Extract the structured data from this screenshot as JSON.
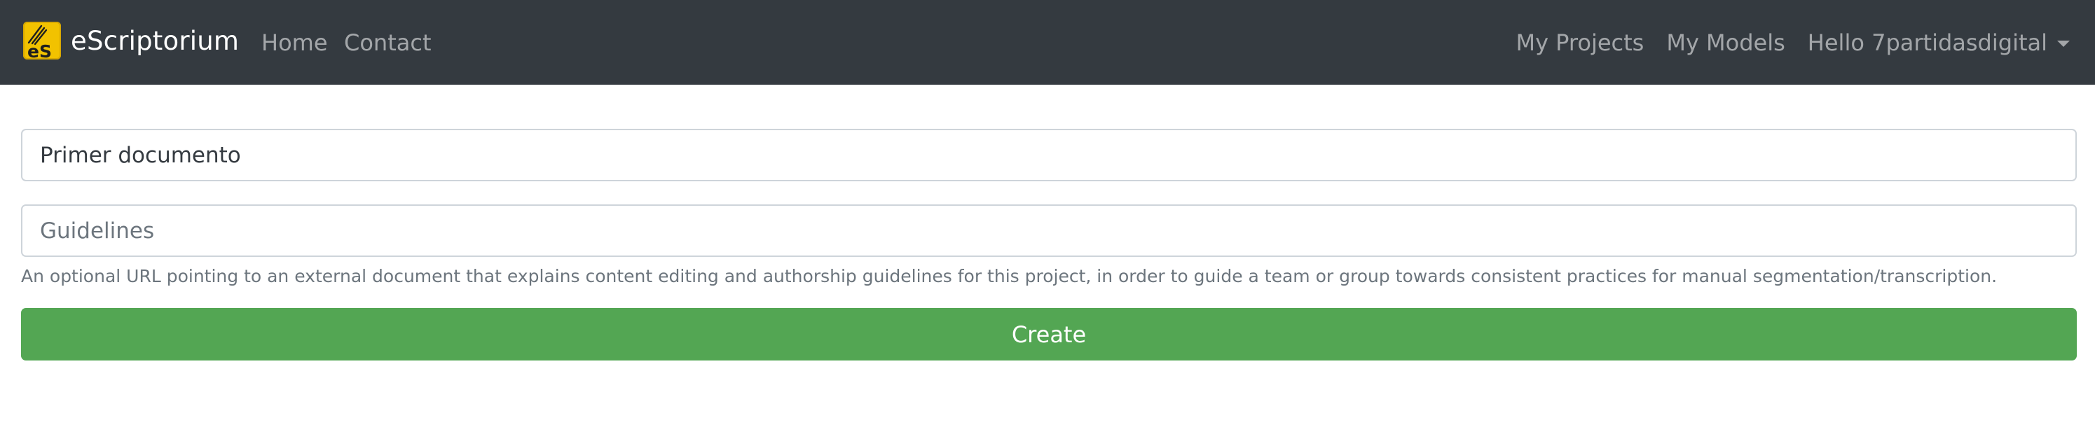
{
  "navbar": {
    "brand_name": "eScriptorium",
    "left_links": [
      {
        "label": "Home"
      },
      {
        "label": "Contact"
      }
    ],
    "right_links": [
      {
        "label": "My Projects"
      },
      {
        "label": "My Models"
      }
    ],
    "user_menu_label": "Hello 7partidasdigital"
  },
  "form": {
    "name_value": "Primer documento",
    "guidelines_placeholder": "Guidelines",
    "guidelines_value": "",
    "guidelines_help": "An optional URL pointing to an external document that explains content editing and authorship guidelines for this project, in order to guide a team or group towards consistent practices for manual segmentation/transcription.",
    "submit_label": "Create"
  },
  "colors": {
    "navbar_bg": "#343a40",
    "logo_yellow": "#f2c200",
    "create_button": "#53a653"
  },
  "icons": {
    "logo": "escriptorium-logo-icon",
    "dropdown": "chevron-down-icon"
  }
}
